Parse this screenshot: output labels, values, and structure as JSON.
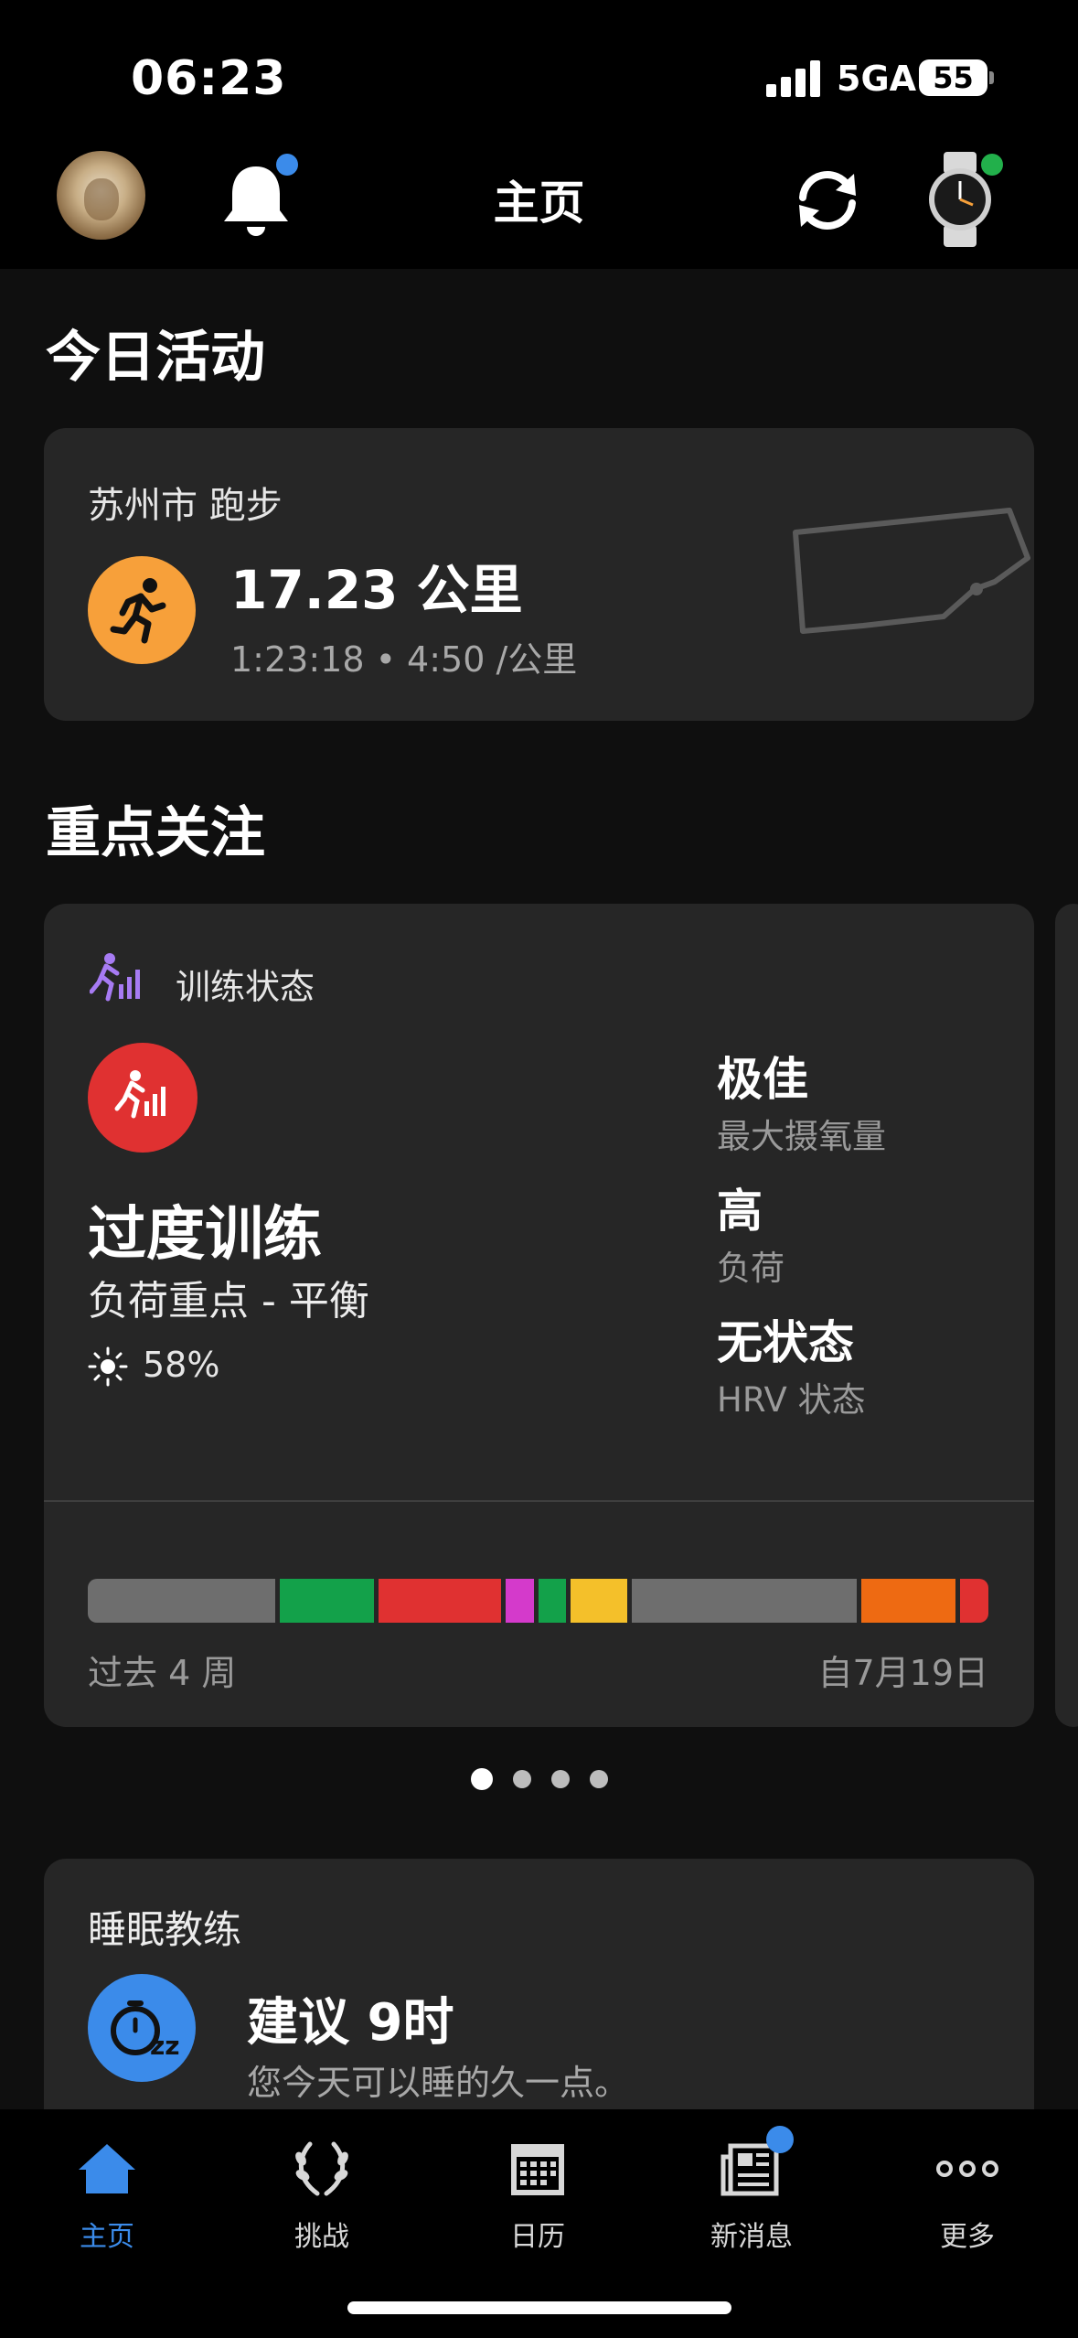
{
  "status_bar": {
    "time": "06:23",
    "network": "5GA",
    "battery": "55"
  },
  "header": {
    "title": "主页"
  },
  "today": {
    "section_title": "今日活动",
    "activity": {
      "location_type": "苏州市 跑步",
      "distance": "17.23 公里",
      "details": "1:23:18 • 4:50 /公里",
      "icon": "running-icon"
    }
  },
  "focus": {
    "section_title": "重点关注",
    "training_status": {
      "header": "训练状态",
      "status": "过度训练",
      "load_focus": "负荷重点 - 平衡",
      "acclimation": "58%",
      "metrics": [
        {
          "value": "极佳",
          "label": "最大摄氧量"
        },
        {
          "value": "高",
          "label": "负荷"
        },
        {
          "value": "无状态",
          "label": "HRV 状态"
        }
      ],
      "history_segments": [
        {
          "color": "#6e6e6e",
          "weight": 20
        },
        {
          "color": "#13a14a",
          "weight": 10
        },
        {
          "color": "#e03131",
          "weight": 13
        },
        {
          "color": "#d43acb",
          "weight": 3
        },
        {
          "color": "#13a14a",
          "weight": 3
        },
        {
          "color": "#f4c02a",
          "weight": 6
        },
        {
          "color": "#6e6e6e",
          "weight": 24
        },
        {
          "color": "#ee6a12",
          "weight": 10
        },
        {
          "color": "#e03131",
          "weight": 3
        }
      ],
      "history_left": "过去 4 周",
      "history_right": "自7月19日"
    },
    "pager": {
      "pages": 4,
      "active": 0
    }
  },
  "sleep": {
    "title": "睡眠教练",
    "recommendation": "建议 9时",
    "message": "您今天可以睡的久一点。"
  },
  "tabs": [
    {
      "label": "主页",
      "icon": "home-icon",
      "active": true
    },
    {
      "label": "挑战",
      "icon": "laurel-icon",
      "active": false
    },
    {
      "label": "日历",
      "icon": "calendar-icon",
      "active": false
    },
    {
      "label": "新消息",
      "icon": "news-icon",
      "active": false,
      "badge": true
    },
    {
      "label": "更多",
      "icon": "more-icon",
      "active": false
    }
  ],
  "colors": {
    "accent": "#3b8bea",
    "run": "#f7a03a",
    "overtraining": "#e03131",
    "card": "#262626"
  }
}
